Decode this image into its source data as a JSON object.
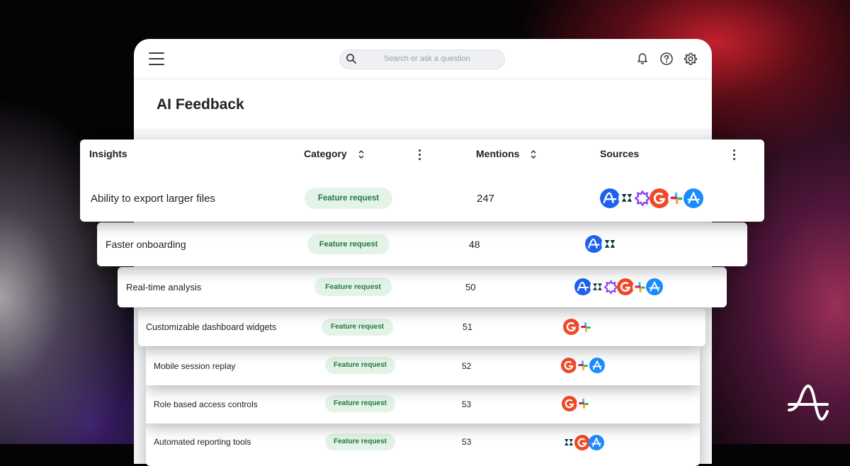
{
  "search": {
    "placeholder": "Search or ask a question"
  },
  "page": {
    "title": "AI Feedback"
  },
  "table": {
    "columns": [
      "Insights",
      "Category",
      "Mentions",
      "Sources"
    ],
    "rows": [
      {
        "insight": "Ability to export larger files",
        "category": "Feature request",
        "mentions": "247",
        "sources": [
          "amplitude-icon",
          "zendesk-icon",
          "gong-icon",
          "g2-icon",
          "slack-icon",
          "app-store-icon"
        ]
      },
      {
        "insight": "Faster onboarding",
        "category": "Feature request",
        "mentions": "48",
        "sources": [
          "amplitude-icon",
          "zendesk-icon"
        ]
      },
      {
        "insight": "Real-time analysis",
        "category": "Feature request",
        "mentions": "50",
        "sources": [
          "amplitude-icon",
          "zendesk-icon",
          "gong-icon",
          "g2-icon",
          "slack-icon",
          "app-store-icon"
        ]
      },
      {
        "insight": "Customizable dashboard widgets",
        "category": "Feature request",
        "mentions": "51",
        "sources": [
          "g2-icon",
          "slack-icon"
        ]
      },
      {
        "insight": "Mobile session replay",
        "category": "Feature request",
        "mentions": "52",
        "sources": [
          "g2-icon",
          "slack-icon",
          "app-store-icon"
        ]
      },
      {
        "insight": "Role based access controls",
        "category": "Feature request",
        "mentions": "53",
        "sources": [
          "g2-icon",
          "slack-icon"
        ]
      },
      {
        "insight": "Automated reporting tools",
        "category": "Feature request",
        "mentions": "53",
        "sources": [
          "zendesk-icon",
          "g2-icon",
          "app-store-icon"
        ]
      }
    ]
  },
  "colors": {
    "pill_bg": "#e3f3e7",
    "pill_text": "#237a42",
    "amplitude_blue": "#1e61f0",
    "g2_red": "#ef4a28",
    "gong_purple": "#8a3ffc",
    "app_store_blue": "#1a8cff"
  },
  "icons": {
    "menu": "hamburger-icon",
    "search": "search-icon",
    "notifications": "bell-icon",
    "help": "question-icon",
    "settings": "gear-icon",
    "brand_logo": "amplitude-logo"
  }
}
